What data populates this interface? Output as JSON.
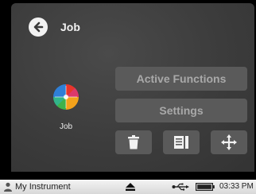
{
  "header": {
    "title": "Job",
    "back_icon": "back-arrow-icon"
  },
  "job_tile": {
    "icon": "color-wheel-icon",
    "label": "Job"
  },
  "menu": {
    "active_functions_label": "Active Functions",
    "settings_label": "Settings"
  },
  "actions": {
    "delete_icon": "trash-icon",
    "copy_icon": "document-list-icon",
    "move_icon": "move-arrows-icon"
  },
  "statusbar": {
    "instrument_name": "My Instrument",
    "time": "03:33 PM",
    "icons": [
      "user-icon",
      "eject-icon",
      "usb-icon",
      "battery-icon"
    ]
  },
  "colors": {
    "panel_bg": "#3c3c3c",
    "button_bg": "#5a5a5a",
    "button_text": "#a9a9a9",
    "text": "#f2f2f2",
    "statusbar_bg": "#e6e6e6"
  }
}
